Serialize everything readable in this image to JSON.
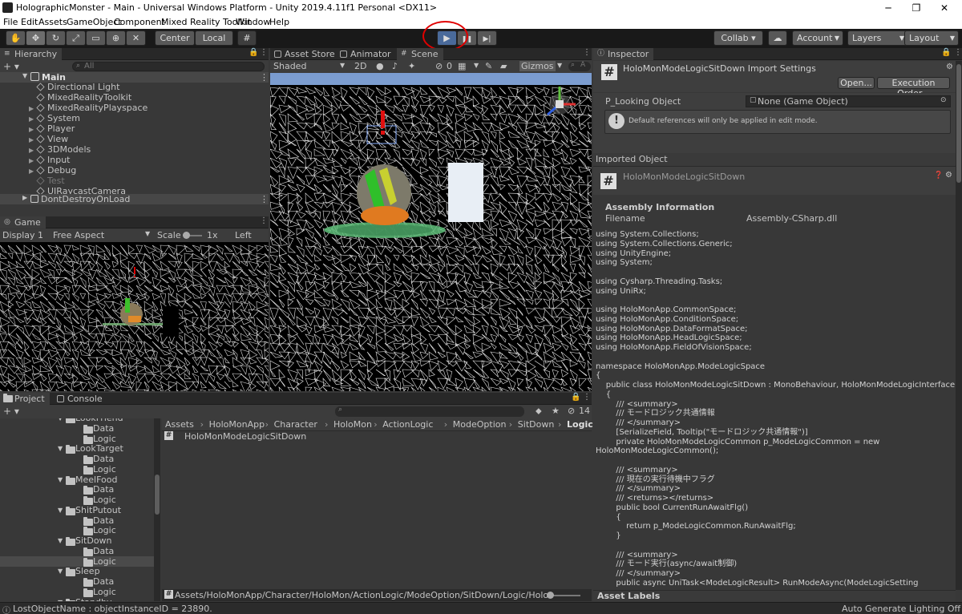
{
  "window": {
    "title": "HolographicMonster - Main - Universal Windows Platform - Unity 2019.4.11f1 Personal <DX11>",
    "minimize": "─",
    "restore": "❐",
    "close": "✕"
  },
  "menu": [
    "File",
    "Edit",
    "Assets",
    "GameObject",
    "Component",
    "Mixed Reality Toolkit",
    "Window",
    "Help"
  ],
  "toolbar": {
    "tools": [
      "hand-tool-icon",
      "move-tool-icon",
      "rotate-tool-icon",
      "scale-tool-icon",
      "rect-tool-icon",
      "transform-tool-icon",
      "custom-tool-icon"
    ],
    "pivot": "Center",
    "space": "Local",
    "play_icon": "▶",
    "pause_icon": "❚❚",
    "step_icon": "▶|",
    "collab": "Collab ▾",
    "account": "Account",
    "layers": "Layers",
    "layout": "Layout"
  },
  "hierarchy": {
    "tab": "Hierarchy",
    "add": "+ ▾",
    "search_placeholder": "All",
    "scene": "Main",
    "items": [
      "Directional Light",
      "MixedRealityToolkit",
      "MixedRealityPlayspace",
      "System",
      "Player",
      "View",
      "3DModels",
      "Input",
      "Debug",
      "Test",
      "UIRaycastCamera"
    ],
    "dontdestroy": "DontDestroyOnLoad"
  },
  "game": {
    "tab": "Game",
    "display": "Display 1",
    "aspect": "Free Aspect",
    "scale_label": "Scale",
    "scale_value": "1x",
    "view": "Left Eye"
  },
  "scene": {
    "tabs": [
      "Asset Store",
      "Animator",
      "Scene"
    ],
    "shading": "Shaded",
    "mode_2d": "2D",
    "fx_count": "0",
    "gizmos": "Gizmos",
    "search_placeholder": "A"
  },
  "project": {
    "tabs": [
      "Project",
      "Console"
    ],
    "add": "+ ▾",
    "badge": "14",
    "tree": [
      {
        "label": "LookFriend",
        "depth": 1,
        "cut": true
      },
      {
        "label": "Data",
        "depth": 2
      },
      {
        "label": "Logic",
        "depth": 2
      },
      {
        "label": "LookTarget",
        "depth": 1
      },
      {
        "label": "Data",
        "depth": 2
      },
      {
        "label": "Logic",
        "depth": 2
      },
      {
        "label": "MeelFood",
        "depth": 1
      },
      {
        "label": "Data",
        "depth": 2
      },
      {
        "label": "Logic",
        "depth": 2
      },
      {
        "label": "ShitPutout",
        "depth": 1
      },
      {
        "label": "Data",
        "depth": 2
      },
      {
        "label": "Logic",
        "depth": 2
      },
      {
        "label": "SitDown",
        "depth": 1
      },
      {
        "label": "Data",
        "depth": 2
      },
      {
        "label": "Logic",
        "depth": 2,
        "selected": true
      },
      {
        "label": "Sleep",
        "depth": 1
      },
      {
        "label": "Data",
        "depth": 2
      },
      {
        "label": "Logic",
        "depth": 2
      },
      {
        "label": "Standby",
        "depth": 1,
        "cut": true
      }
    ],
    "breadcrumb": [
      "Assets",
      "HoloMonApp",
      "Character",
      "HoloMon",
      "ActionLogic",
      "ModeOption",
      "SitDown",
      "Logic"
    ],
    "file": "HoloMonModeLogicSitDown",
    "path": "Assets/HoloMonApp/Character/HoloMon/ActionLogic/ModeOption/SitDown/Logic/HoloMonModeLc"
  },
  "inspector": {
    "tab": "Inspector",
    "title": "HoloMonModeLogicSitDown Import Settings",
    "open_btn": "Open...",
    "exec_btn": "Execution Order...",
    "field_label": "P_Looking Object",
    "field_value": "None (Game Object)",
    "info": "Default references will only be applied in edit mode.",
    "imported": "Imported Object",
    "script_name": "HoloMonModeLogicSitDown",
    "assembly_header": "Assembly Information",
    "filename_label": "Filename",
    "filename_value": "Assembly-CSharp.dll",
    "code": [
      "using System.Collections;",
      "using System.Collections.Generic;",
      "using UnityEngine;",
      "using System;",
      "",
      "using Cysharp.Threading.Tasks;",
      "using UniRx;",
      "",
      "using HoloMonApp.CommonSpace;",
      "using HoloMonApp.ConditionSpace;",
      "using HoloMonApp.DataFormatSpace;",
      "using HoloMonApp.HeadLogicSpace;",
      "using HoloMonApp.FieldOfVisionSpace;",
      "",
      "namespace HoloMonApp.ModeLogicSpace",
      "{",
      "    public class HoloMonModeLogicSitDown : MonoBehaviour, HoloMonModeLogicInterface",
      "    {",
      "        /// <summary>",
      "        /// モードロジック共通情報",
      "        /// </summary>",
      "        [SerializeField, Tooltip(\"モードロジック共通情報\")]",
      "        private HoloMonModeLogicCommon p_ModeLogicCommon = new",
      "HoloMonModeLogicCommon();",
      "",
      "        /// <summary>",
      "        /// 現在の実行待機中フラグ",
      "        /// </summary>",
      "        /// <returns></returns>",
      "        public bool CurrentRunAwaitFlg()",
      "        {",
      "            return p_ModeLogicCommon.RunAwaitFlg;",
      "        }",
      "",
      "        /// <summary>",
      "        /// モード実行(async/await制御)",
      "        /// </summary>",
      "        public async UniTask<ModeLogicResult> RunModeAsync(ModeLogicSetting"
    ],
    "asset_labels": "Asset Labels"
  },
  "status": {
    "message": "LostObjectName : objectInstanceID = 23890.",
    "right": "Auto Generate Lighting Off"
  }
}
